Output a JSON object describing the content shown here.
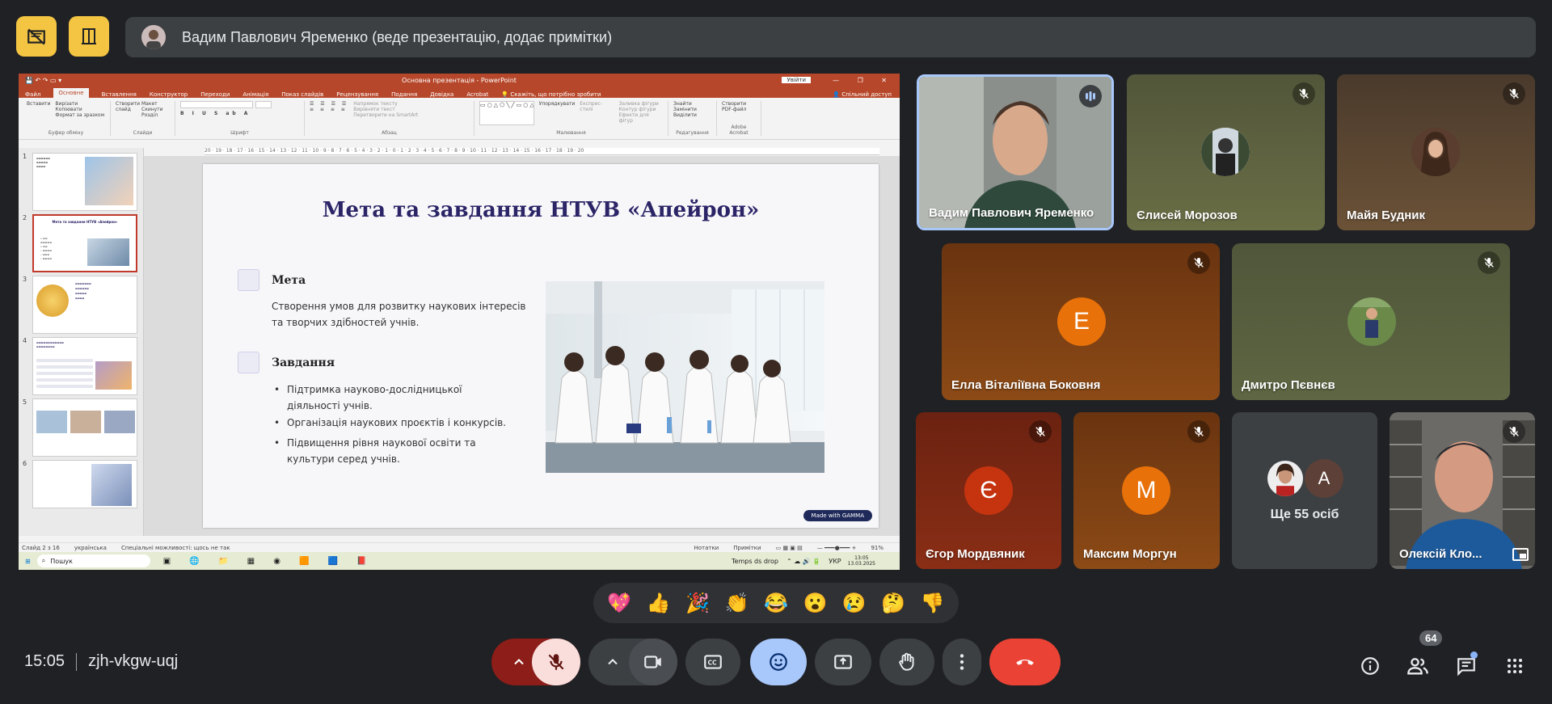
{
  "header": {
    "presenter_text": "Вадим Павлович Яременко (веде презентацію, додає примітки)"
  },
  "powerpoint": {
    "window_title": "Основна презентація - PowerPoint",
    "share_button": "Увійти",
    "menu": [
      "Файл",
      "Основне",
      "Вставлення",
      "Конструктор",
      "Переходи",
      "Анімація",
      "Показ слайдів",
      "Рецензування",
      "Подання",
      "Довідка",
      "Acrobat"
    ],
    "tell_me": "Скажіть, що потрібно зробити",
    "shared_access": "Спільний доступ",
    "ribbon_groups": {
      "clipboard": "Буфер обміну",
      "clipboard_items": [
        "Вставити",
        "Вирізати",
        "Копіювати",
        "Формат за зразком"
      ],
      "slides": "Слайди",
      "slides_items": [
        "Створити слайд",
        "Макет",
        "Скинути",
        "Розділ"
      ],
      "font": "Шрифт",
      "paragraph": "Абзац",
      "paragraph_items": [
        "Напрямок тексту",
        "Вирівняти текст",
        "Перетворити на SmartArt"
      ],
      "drawing": "Малювання",
      "drawing_items": [
        "Упорядкувати",
        "Експрес-стилі",
        "Заливка фігури",
        "Контур фігури",
        "Ефекти для фігур"
      ],
      "editing": "Редагування",
      "editing_items": [
        "Знайти",
        "Замінити",
        "Виділити"
      ],
      "acrobat": "Adobe Acrobat",
      "acrobat_items": [
        "Створити PDF-файл"
      ]
    },
    "ruler_text": "20 · 19 · 18 · 17 · 16 · 15 · 14 · 13 · 12 · 11 · 10 · 9 · 8 · 7 · 6 · 5 · 4 · 3 · 2 · 1 · 0 · 1 · 2 · 3 · 4 · 5 · 6 · 7 · 8 · 9 · 10 · 11 · 12 · 13 · 14 · 15 · 16 · 17 · 18 · 19 · 20",
    "thumb_numbers": [
      "1",
      "2",
      "3",
      "4",
      "5",
      "6"
    ],
    "thumb_titles": [
      "",
      "Мета та завдання НТУВ «Апейрон»",
      "",
      "",
      "",
      ""
    ],
    "status": {
      "slide": "Слайд 2 з 16",
      "lang": "українська",
      "accessibility": "Спеціальні можливості: щось не так",
      "notes": "Нотатки",
      "comments": "Примітки",
      "zoom": "91%"
    },
    "taskbar": {
      "search": "Пошук",
      "weather": "Temps ds drop",
      "lang": "УКР",
      "time": "13:05",
      "date": "13.03.2025"
    }
  },
  "slide": {
    "title": "Мета та завдання НТУВ «Апейрон»",
    "goal_heading": "Мета",
    "goal_text": "Створення умов для розвитку наукових інтересів та творчих здібностей учнів.",
    "tasks_heading": "Завдання",
    "tasks": [
      "Підтримка науково-дослідницької діяльності учнів.",
      "Організація наукових проєктів і конкурсів.",
      "Підвищення рівня наукової освіти та культури серед учнів."
    ],
    "made_with": "Made with GAMMA"
  },
  "participants": {
    "p1": "Вадим Павлович Яременко",
    "p2": "Єлисей Морозов",
    "p3": "Майя Будник",
    "p4": "Елла Віталіївна Боковня",
    "p4_initial": "Е",
    "p5": "Дмитро Пєвнєв",
    "p6": "Єгор Мордвяник",
    "p6_initial": "Є",
    "p7": "Максим Моргун",
    "p7_initial": "М",
    "others_label": "Ще 55 осіб",
    "others_initial": "А",
    "p9": "Олексій Кло..."
  },
  "reactions": [
    "💖",
    "👍",
    "🎉",
    "👏",
    "😂",
    "😮",
    "😢",
    "🤔",
    "👎"
  ],
  "footer": {
    "time": "15:05",
    "meeting_code": "zjh-vkgw-uqj",
    "participants_count": "64"
  },
  "colors": {
    "end_call": "#ea4335",
    "mic_muted_bg": "#f9dedc",
    "reactions_active": "#a8c7fa",
    "raise_hand_yellow": "#f4c542",
    "speaker_border": "#a8c7fa"
  }
}
